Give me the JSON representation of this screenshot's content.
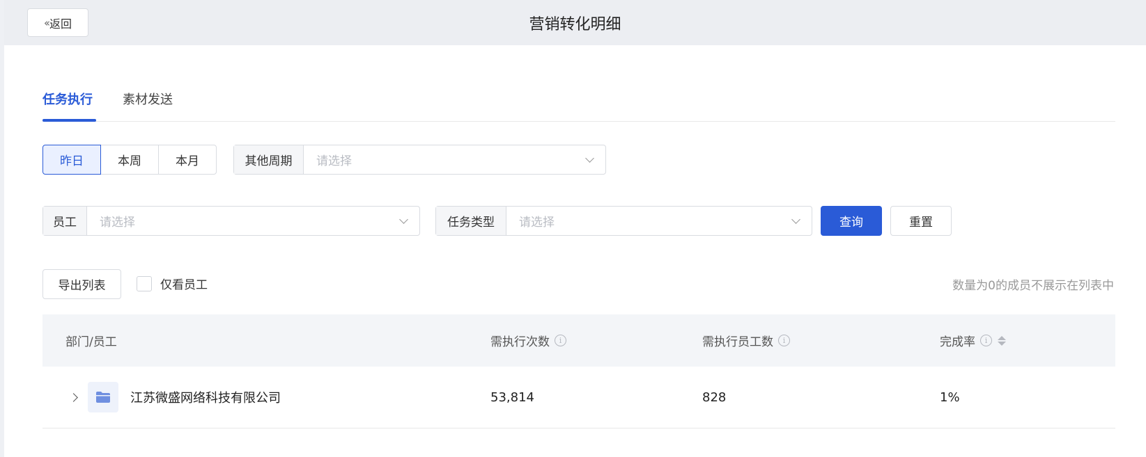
{
  "header": {
    "back_label": "返回",
    "title": "营销转化明细"
  },
  "tabs": [
    {
      "label": "任务执行",
      "active": true
    },
    {
      "label": "素材发送",
      "active": false
    }
  ],
  "period": {
    "options": [
      "昨日",
      "本周",
      "本月"
    ],
    "selected": "昨日",
    "other_label": "其他周期",
    "other_placeholder": "请选择"
  },
  "filters": {
    "employee_label": "员工",
    "employee_placeholder": "请选择",
    "task_type_label": "任务类型",
    "task_type_placeholder": "请选择",
    "query_label": "查询",
    "reset_label": "重置"
  },
  "toolbar": {
    "export_label": "导出列表",
    "only_employees_label": "仅看员工",
    "only_employees_checked": false,
    "hint": "数量为0的成员不展示在列表中"
  },
  "table": {
    "columns": [
      "部门/员工",
      "需执行次数",
      "需执行员工数",
      "完成率"
    ],
    "rows": [
      {
        "name": "江苏微盛网络科技有限公司",
        "executions": "53,814",
        "employees": "828",
        "rate": "1%"
      }
    ]
  },
  "colors": {
    "accent": "#2a5bd7",
    "header_bg": "#eceef2",
    "table_header_bg": "#f3f5f8"
  }
}
